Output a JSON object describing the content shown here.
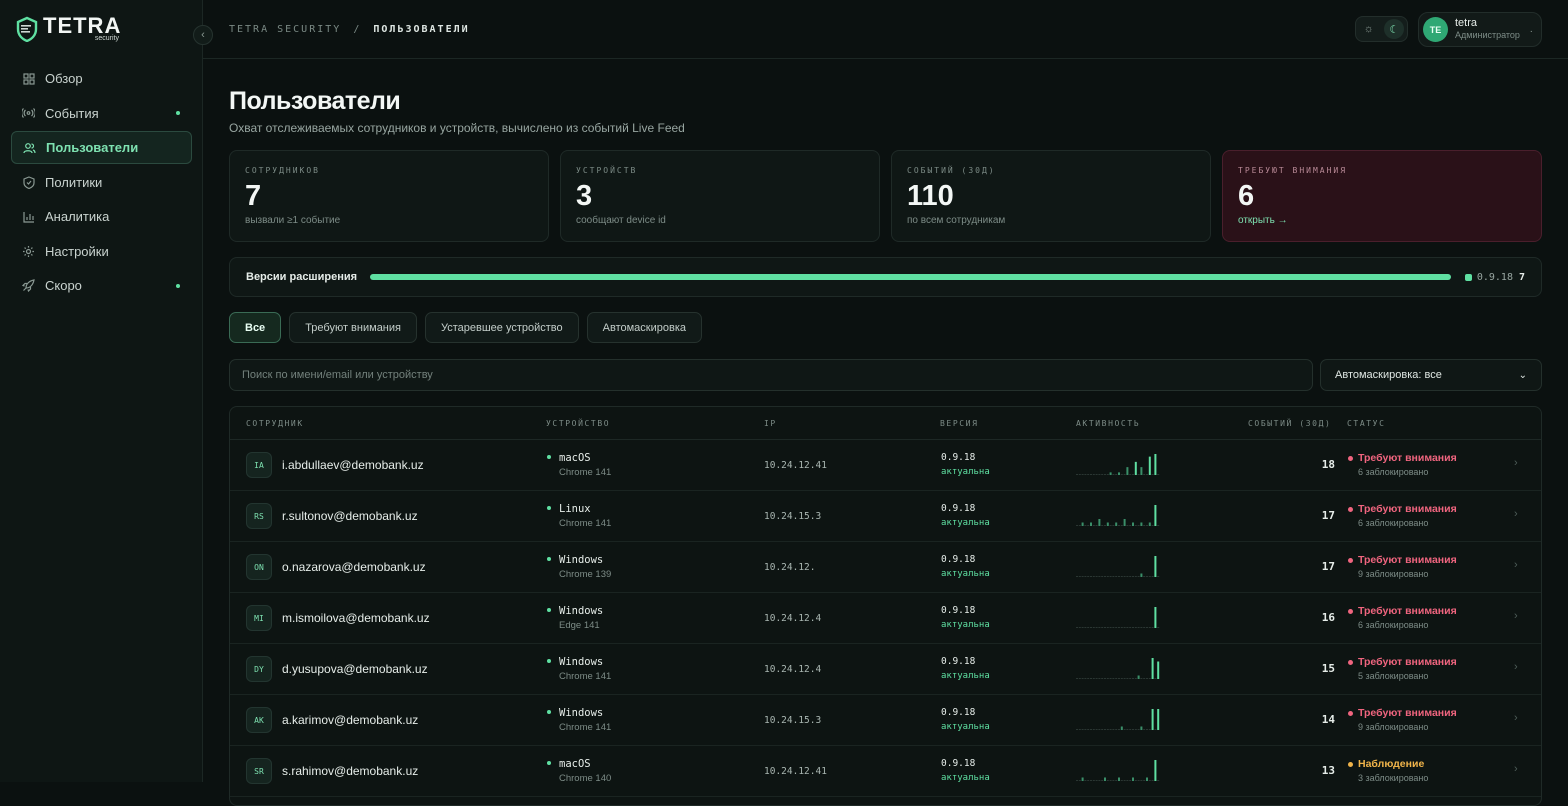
{
  "brand": {
    "name": "TETRA",
    "sub": "security"
  },
  "colors": {
    "accent": "#5fe0a2",
    "alert": "#f0657f",
    "warn": "#f0b44a",
    "bg": "#0b1110"
  },
  "sidebar": {
    "items": [
      {
        "label": "Обзор",
        "icon": "grid-icon",
        "dot": false,
        "active": false
      },
      {
        "label": "События",
        "icon": "broadcast-icon",
        "dot": true,
        "active": false
      },
      {
        "label": "Пользователи",
        "icon": "users-icon",
        "dot": false,
        "active": true
      },
      {
        "label": "Политики",
        "icon": "shield-icon",
        "dot": false,
        "active": false
      },
      {
        "label": "Аналитика",
        "icon": "bar-chart-icon",
        "dot": false,
        "active": false
      },
      {
        "label": "Настройки",
        "icon": "gear-icon",
        "dot": false,
        "active": false
      },
      {
        "label": "Скоро",
        "icon": "rocket-icon",
        "dot": true,
        "active": false
      }
    ]
  },
  "header": {
    "crumb_root": "TETRA SECURITY",
    "crumb_sep": "/",
    "crumb_current": "ПОЛЬЗОВАТЕЛИ",
    "user": {
      "initials": "TE",
      "name": "tetra",
      "role": "Администратор"
    }
  },
  "page": {
    "title": "Пользователи",
    "subtitle": "Охват отслеживаемых сотрудников и устройств, вычислено из событий Live Feed"
  },
  "stats": [
    {
      "label": "СОТРУДНИКОВ",
      "value": "7",
      "sub": "вызвали ≥1 событие",
      "alert": false
    },
    {
      "label": "УСТРОЙСТВ",
      "value": "3",
      "sub": "сообщают device id",
      "alert": false
    },
    {
      "label": "СОБЫТИЙ (30Д)",
      "value": "110",
      "sub": "по всем сотрудникам",
      "alert": false
    },
    {
      "label": "ТРЕБУЮТ ВНИМАНИЯ",
      "value": "6",
      "sub": "открыть →",
      "alert": true
    }
  ],
  "versions": {
    "label": "Версии расширения",
    "items": [
      {
        "name": "0.9.18",
        "count": "7",
        "share": 1.0
      }
    ]
  },
  "tabs": [
    "Все",
    "Требуют внимания",
    "Устаревшее устройство",
    "Автомаскировка"
  ],
  "search": {
    "placeholder": "Поиск по имени/email или устройству",
    "value": ""
  },
  "filter": {
    "selected": "Автомаскировка: все"
  },
  "table": {
    "headers": [
      "СОТРУДНИК",
      "УСТРОЙСТВО",
      "IP",
      "ВЕРСИЯ",
      "АКТИВНОСТЬ",
      "СОБЫТИЙ (30Д)",
      "СТАТУС"
    ],
    "rows": [
      {
        "initials": "IA",
        "email": "i.abdullaev@demobank.uz",
        "os": "macOS",
        "browser": "Chrome 141",
        "ip": "10.24.12.41",
        "version": "0.9.18",
        "version_status": "актуальна",
        "activity": [
          0,
          0,
          0,
          0,
          0,
          0,
          0,
          0,
          0,
          0,
          0,
          0,
          1,
          0,
          0,
          1,
          0,
          0,
          3,
          0,
          0,
          5,
          0,
          3,
          0,
          0,
          7,
          0,
          8,
          0
        ],
        "events": "18",
        "status": "Требуют внимания",
        "status_kind": "alert",
        "status_sub": "6 заблокировано"
      },
      {
        "initials": "RS",
        "email": "r.sultonov@demobank.uz",
        "os": "Linux",
        "browser": "Chrome 141",
        "ip": "10.24.15.3",
        "version": "0.9.18",
        "version_status": "актуальна",
        "activity": [
          0,
          0,
          1,
          0,
          0,
          1,
          0,
          0,
          2,
          0,
          0,
          1,
          0,
          0,
          1,
          0,
          0,
          2,
          0,
          0,
          1,
          0,
          0,
          1,
          0,
          0,
          1,
          0,
          6,
          0
        ],
        "events": "17",
        "status": "Требуют внимания",
        "status_kind": "alert",
        "status_sub": "6 заблокировано"
      },
      {
        "initials": "ON",
        "email": "o.nazarova@demobank.uz",
        "os": "Windows",
        "browser": "Chrome 139",
        "ip": "10.24.12.",
        "version": "0.9.18",
        "version_status": "актуальна",
        "activity": [
          0,
          0,
          0,
          0,
          0,
          0,
          0,
          0,
          0,
          0,
          0,
          0,
          0,
          0,
          0,
          0,
          0,
          0,
          0,
          0,
          0,
          0,
          0,
          1,
          0,
          0,
          0,
          0,
          6,
          0
        ],
        "events": "17",
        "status": "Требуют внимания",
        "status_kind": "alert",
        "status_sub": "9 заблокировано"
      },
      {
        "initials": "MI",
        "email": "m.ismoilova@demobank.uz",
        "os": "Windows",
        "browser": "Edge 141",
        "ip": "10.24.12.4",
        "version": "0.9.18",
        "version_status": "актуальна",
        "activity": [
          0,
          0,
          0,
          0,
          0,
          0,
          0,
          0,
          0,
          0,
          0,
          0,
          0,
          0,
          0,
          0,
          0,
          0,
          0,
          0,
          0,
          0,
          0,
          0,
          0,
          0,
          0,
          0,
          6,
          0
        ],
        "events": "16",
        "status": "Требуют внимания",
        "status_kind": "alert",
        "status_sub": "6 заблокировано"
      },
      {
        "initials": "DY",
        "email": "d.yusupova@demobank.uz",
        "os": "Windows",
        "browser": "Chrome 141",
        "ip": "10.24.12.4",
        "version": "0.9.18",
        "version_status": "актуальна",
        "activity": [
          0,
          0,
          0,
          0,
          0,
          0,
          0,
          0,
          0,
          0,
          0,
          0,
          0,
          0,
          0,
          0,
          0,
          0,
          0,
          0,
          0,
          0,
          1,
          0,
          0,
          0,
          0,
          6,
          0,
          5
        ],
        "events": "15",
        "status": "Требуют внимания",
        "status_kind": "alert",
        "status_sub": "5 заблокировано"
      },
      {
        "initials": "AK",
        "email": "a.karimov@demobank.uz",
        "os": "Windows",
        "browser": "Chrome 141",
        "ip": "10.24.15.3",
        "version": "0.9.18",
        "version_status": "актуальна",
        "activity": [
          0,
          0,
          0,
          0,
          0,
          0,
          0,
          0,
          0,
          0,
          0,
          0,
          0,
          0,
          0,
          0,
          1,
          0,
          0,
          0,
          0,
          0,
          0,
          1,
          0,
          0,
          0,
          6,
          0,
          6
        ],
        "events": "14",
        "status": "Требуют внимания",
        "status_kind": "alert",
        "status_sub": "9 заблокировано"
      },
      {
        "initials": "SR",
        "email": "s.rahimov@demobank.uz",
        "os": "macOS",
        "browser": "Chrome 140",
        "ip": "10.24.12.41",
        "version": "0.9.18",
        "version_status": "актуальна",
        "activity": [
          0,
          0,
          1,
          0,
          0,
          0,
          0,
          0,
          0,
          0,
          1,
          0,
          0,
          0,
          0,
          1,
          0,
          0,
          0,
          0,
          1,
          0,
          0,
          0,
          0,
          1,
          0,
          0,
          6,
          0
        ],
        "events": "13",
        "status": "Наблюдение",
        "status_kind": "warn",
        "status_sub": "3 заблокировано"
      }
    ]
  }
}
